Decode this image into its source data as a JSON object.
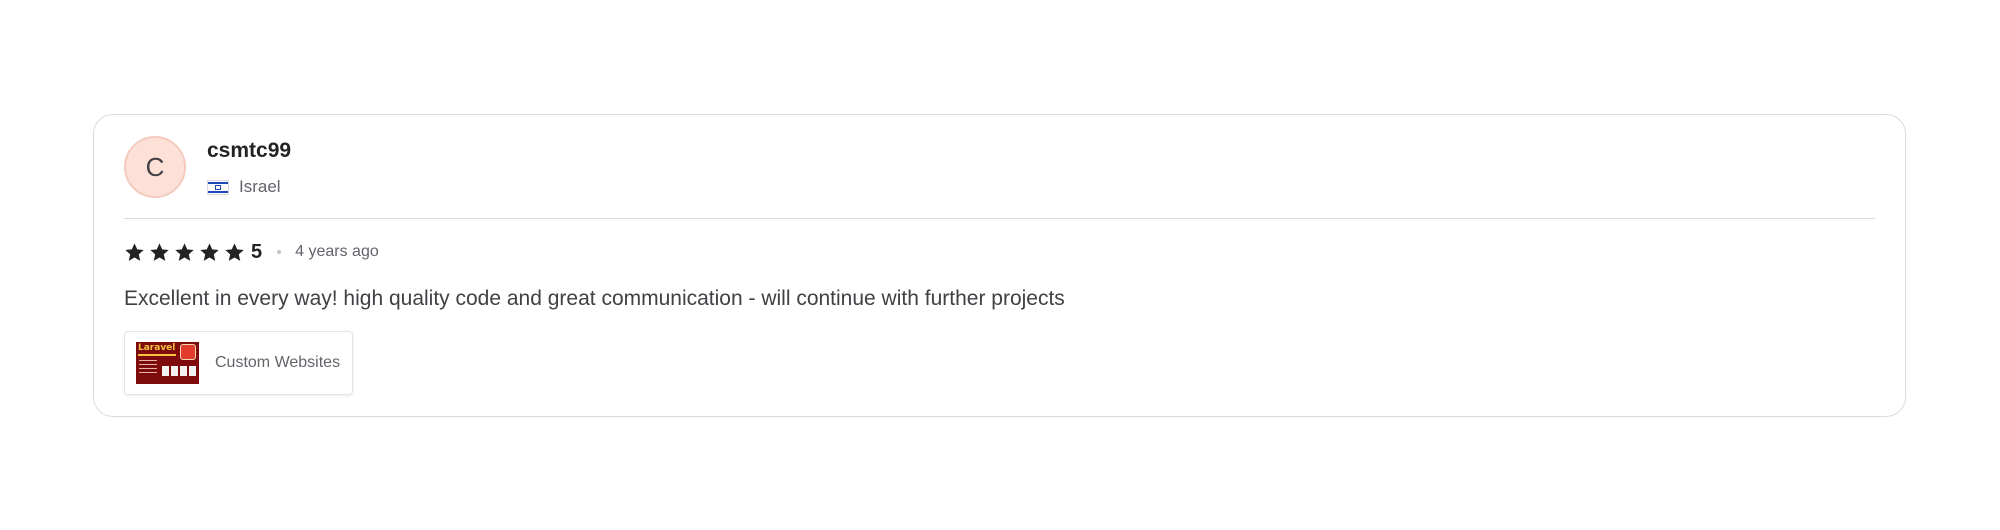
{
  "review": {
    "reviewer": {
      "avatar_initial": "C",
      "username": "csmtc99",
      "country": "Israel",
      "flag_icon": "israel-flag-icon"
    },
    "rating": {
      "stars": 5,
      "star_icon": "star-icon",
      "value": "5"
    },
    "time_ago": "4 years ago",
    "text": "Excellent in every way! high quality code and great communication - will continue with further projects",
    "service": {
      "name": "Custom Websites",
      "thumbnail_text": "Laravel"
    }
  },
  "colors": {
    "avatar_bg": "#fde1d7",
    "star": "#222325",
    "border": "#dadbdd",
    "muted_text": "#62646a"
  }
}
